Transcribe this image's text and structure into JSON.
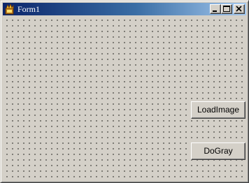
{
  "window": {
    "title": "Form1",
    "icon": "delphi-form-icon",
    "caption_buttons": [
      "minimize-icon",
      "maximize-icon",
      "close-icon"
    ]
  },
  "buttons": {
    "load_image": "LoadImage",
    "do_gray": "DoGray"
  },
  "colors": {
    "face": "#d4d0c8",
    "title_start": "#0a246a",
    "title_end": "#a6caf0",
    "title_text": "#ffffff",
    "grid_dot": "#000000"
  }
}
